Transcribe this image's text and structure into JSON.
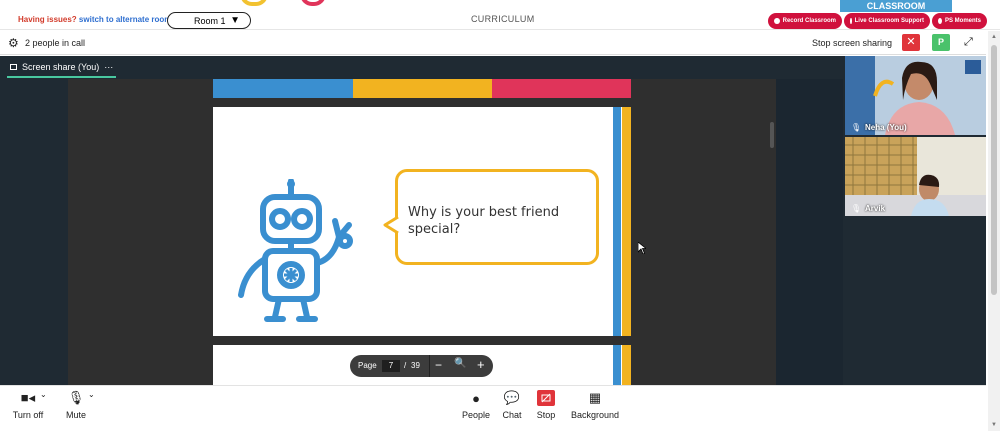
{
  "topbar": {
    "issues_text": "Having issues?",
    "alternate_link": "switch to alternate room",
    "room_label": "Room 1",
    "curriculum_label": "CURRICULUM",
    "classroom_label": "CLASSROOM",
    "record_label": "Record Classroom",
    "support_label": "Live Classroom Support",
    "moments_label": "PS Moments",
    "accent_red": "#d0113d"
  },
  "call": {
    "people_count": "2 people in call",
    "stop_sharing": "Stop screen sharing",
    "close_symbol": "✕",
    "avatar_letter": "P"
  },
  "share": {
    "tab_label": "Screen share (You)",
    "more_symbol": "···"
  },
  "slide": {
    "question_line1": "Why is your best friend",
    "question_line2": "special?",
    "colorbar": [
      "#3a8fd0",
      "#f2b320",
      "#e0345a"
    ]
  },
  "pager": {
    "page_label": "Page",
    "current_page": "7",
    "separator": "/",
    "total_pages": "39",
    "minus": "−",
    "plus": "+"
  },
  "participants": [
    {
      "name": "Neha (You)"
    },
    {
      "name": "Arvik"
    }
  ],
  "toolbar": {
    "turn_off": "Turn off",
    "mute": "Mute",
    "people": "People",
    "chat": "Chat",
    "stop": "Stop",
    "background": "Background"
  }
}
